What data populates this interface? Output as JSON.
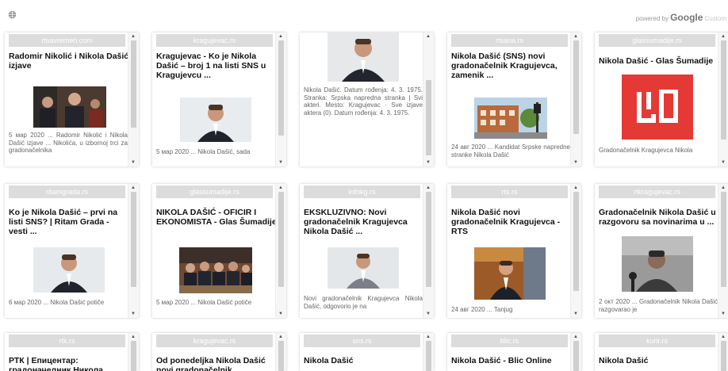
{
  "header": {
    "powered_prefix": "powered by",
    "google": "Google",
    "custom": "Custom"
  },
  "colors": {
    "logo_red": "#e53935",
    "header_band": "#dcdcdc",
    "scroll_thumb": "#cfcfcf"
  },
  "cards": [
    {
      "source": "rtsavremen.com",
      "title": "Radomir Nikolić i Nikola Dašić izjave",
      "snippet": "5 мар 2020 ... Radomir Nikolić i Nikola Dašić izjave ... Nikolića, u izbornoj trci za gradonačelnika",
      "thumb": "photo-men-icon"
    },
    {
      "source": "kragujevac.rs",
      "title": "Kragujevac - Ko je Nikola Dašić – broj 1 na listi SNS u Kragujevcu ...",
      "snippet": "5 мар 2020 ... Nikola Dašić, sada",
      "thumb": "portrait-icon"
    },
    {
      "source": "",
      "title": "",
      "snippet": "Nikola Dašić. Datum rođenja: 4. 3. 1975. Stranka: Srpska napredna stranka | Svi akteri. Mesto: Kragujevac · Sve izjave aktera (0). Datum rođenja: 4. 3. 1975.",
      "thumb": "portrait-icon"
    },
    {
      "source": "rtsana.rs",
      "title": "Nikola Dašić (SNS) novi gradonačelnik Kragujevca, zamenik ...",
      "snippet": "24 авг 2020 ... Kandidat Srpske napredne stranke Nikola Dašić",
      "thumb": "building-photo-icon"
    },
    {
      "source": "glassumadije.rs",
      "title": "Nikola Dašić - Glas Šumadije",
      "snippet": "Gradonačelnik Kragujevca Nikola",
      "thumb": "gs-logo-icon"
    },
    {
      "source": "ritamgrada.rs",
      "title": "Ko je Nikola Dašić – prvi na listi SNS? | Ritam Grada - vesti ...",
      "snippet": "6 мар 2020 ... Nikola Dašić potiče",
      "thumb": "portrait-icon"
    },
    {
      "source": "glassumadije.rs",
      "title": "NIKOLA DAŠIĆ - OFICIR I EKONOMISTA - Glas Šumadije",
      "snippet": "5 мар 2020 ... Nikola Dašić potiče",
      "thumb": "group-photo-icon"
    },
    {
      "source": "infokg.rs",
      "title": "EKSKLUZIVNO: Novi gradonačelnik Kragujevca Nikola Dašić ...",
      "snippet": "Novi gradonačelnik Kragujevca Nikola Dašić, odgovorio je na",
      "thumb": "portrait-icon"
    },
    {
      "source": "rts.rs",
      "title": "Nikola Dašić novi gradonačelnik Kragujevca - RTS",
      "snippet": "24 авг 2020 ... Tanjug",
      "thumb": "speech-photo-icon"
    },
    {
      "source": "rtkragujevac.rs",
      "title": "Gradonačelnik Nikola Dašić u razgovoru sa novinarima u ...",
      "snippet": "2 окт 2020 ... Gradonačelnik Nikola Dašić razgovarao je",
      "thumb": "mic-photo-icon"
    },
    {
      "source": "rtk.rs",
      "title": "РТК | Епицентар: градоначелник Никола",
      "snippet": "",
      "thumb": ""
    },
    {
      "source": "kragujevac.rs",
      "title": "Od ponedeljka Nikola Dašić novi gradonačelnik",
      "snippet": "",
      "thumb": ""
    },
    {
      "source": "sns.rs",
      "title": "Nikola Dašić",
      "snippet": "",
      "thumb": ""
    },
    {
      "source": "blic.rs",
      "title": "Nikola Dašić - Blic Online",
      "snippet": "",
      "thumb": ""
    },
    {
      "source": "kurir.rs",
      "title": "Nikola Dašić",
      "snippet": "",
      "thumb": ""
    }
  ]
}
